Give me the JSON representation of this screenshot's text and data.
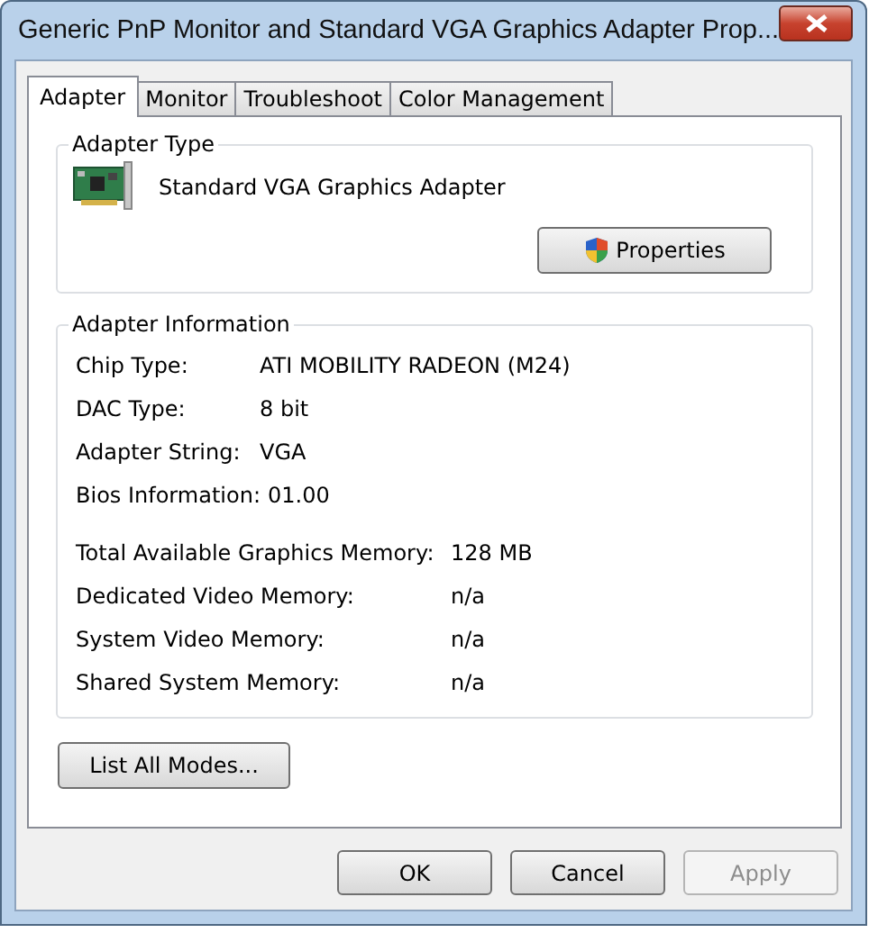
{
  "window": {
    "title": "Generic PnP Monitor and Standard VGA Graphics Adapter Prop..."
  },
  "tabs": [
    {
      "label": "Adapter",
      "selected": true
    },
    {
      "label": "Monitor",
      "selected": false
    },
    {
      "label": "Troubleshoot",
      "selected": false
    },
    {
      "label": "Color Management",
      "selected": false
    }
  ],
  "adapter_type": {
    "title": "Adapter Type",
    "name": "Standard VGA Graphics Adapter",
    "button": "Properties"
  },
  "adapter_information": {
    "title": "Adapter Information",
    "rows": [
      {
        "label": "Chip Type:",
        "value": "ATI MOBILITY RADEON (M24)"
      },
      {
        "label": "DAC Type:",
        "value": "8 bit"
      },
      {
        "label": "Adapter String:",
        "value": "VGA"
      },
      {
        "label": "Bios Information:",
        "value": "01.00",
        "kind": "inline"
      }
    ],
    "memory_rows": [
      {
        "label": "Total Available Graphics Memory:",
        "value": "128 MB"
      },
      {
        "label": "Dedicated Video Memory:",
        "value": "n/a"
      },
      {
        "label": "System Video Memory:",
        "value": "n/a"
      },
      {
        "label": "Shared System Memory:",
        "value": "n/a"
      }
    ]
  },
  "list_button": "List All Modes...",
  "buttons": [
    {
      "label": "OK",
      "disabled": false
    },
    {
      "label": "Cancel",
      "disabled": false
    },
    {
      "label": "Apply",
      "disabled": true
    }
  ]
}
